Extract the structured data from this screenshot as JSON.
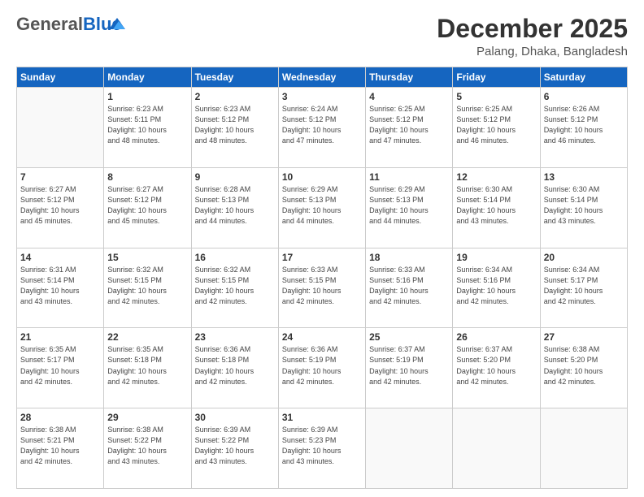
{
  "header": {
    "logo_general": "General",
    "logo_blue": "Blue",
    "month": "December 2025",
    "location": "Palang, Dhaka, Bangladesh"
  },
  "days_of_week": [
    "Sunday",
    "Monday",
    "Tuesday",
    "Wednesday",
    "Thursday",
    "Friday",
    "Saturday"
  ],
  "weeks": [
    [
      {
        "day": "",
        "info": ""
      },
      {
        "day": "1",
        "info": "Sunrise: 6:23 AM\nSunset: 5:11 PM\nDaylight: 10 hours\nand 48 minutes."
      },
      {
        "day": "2",
        "info": "Sunrise: 6:23 AM\nSunset: 5:12 PM\nDaylight: 10 hours\nand 48 minutes."
      },
      {
        "day": "3",
        "info": "Sunrise: 6:24 AM\nSunset: 5:12 PM\nDaylight: 10 hours\nand 47 minutes."
      },
      {
        "day": "4",
        "info": "Sunrise: 6:25 AM\nSunset: 5:12 PM\nDaylight: 10 hours\nand 47 minutes."
      },
      {
        "day": "5",
        "info": "Sunrise: 6:25 AM\nSunset: 5:12 PM\nDaylight: 10 hours\nand 46 minutes."
      },
      {
        "day": "6",
        "info": "Sunrise: 6:26 AM\nSunset: 5:12 PM\nDaylight: 10 hours\nand 46 minutes."
      }
    ],
    [
      {
        "day": "7",
        "info": "Sunrise: 6:27 AM\nSunset: 5:12 PM\nDaylight: 10 hours\nand 45 minutes."
      },
      {
        "day": "8",
        "info": "Sunrise: 6:27 AM\nSunset: 5:12 PM\nDaylight: 10 hours\nand 45 minutes."
      },
      {
        "day": "9",
        "info": "Sunrise: 6:28 AM\nSunset: 5:13 PM\nDaylight: 10 hours\nand 44 minutes."
      },
      {
        "day": "10",
        "info": "Sunrise: 6:29 AM\nSunset: 5:13 PM\nDaylight: 10 hours\nand 44 minutes."
      },
      {
        "day": "11",
        "info": "Sunrise: 6:29 AM\nSunset: 5:13 PM\nDaylight: 10 hours\nand 44 minutes."
      },
      {
        "day": "12",
        "info": "Sunrise: 6:30 AM\nSunset: 5:14 PM\nDaylight: 10 hours\nand 43 minutes."
      },
      {
        "day": "13",
        "info": "Sunrise: 6:30 AM\nSunset: 5:14 PM\nDaylight: 10 hours\nand 43 minutes."
      }
    ],
    [
      {
        "day": "14",
        "info": "Sunrise: 6:31 AM\nSunset: 5:14 PM\nDaylight: 10 hours\nand 43 minutes."
      },
      {
        "day": "15",
        "info": "Sunrise: 6:32 AM\nSunset: 5:15 PM\nDaylight: 10 hours\nand 42 minutes."
      },
      {
        "day": "16",
        "info": "Sunrise: 6:32 AM\nSunset: 5:15 PM\nDaylight: 10 hours\nand 42 minutes."
      },
      {
        "day": "17",
        "info": "Sunrise: 6:33 AM\nSunset: 5:15 PM\nDaylight: 10 hours\nand 42 minutes."
      },
      {
        "day": "18",
        "info": "Sunrise: 6:33 AM\nSunset: 5:16 PM\nDaylight: 10 hours\nand 42 minutes."
      },
      {
        "day": "19",
        "info": "Sunrise: 6:34 AM\nSunset: 5:16 PM\nDaylight: 10 hours\nand 42 minutes."
      },
      {
        "day": "20",
        "info": "Sunrise: 6:34 AM\nSunset: 5:17 PM\nDaylight: 10 hours\nand 42 minutes."
      }
    ],
    [
      {
        "day": "21",
        "info": "Sunrise: 6:35 AM\nSunset: 5:17 PM\nDaylight: 10 hours\nand 42 minutes."
      },
      {
        "day": "22",
        "info": "Sunrise: 6:35 AM\nSunset: 5:18 PM\nDaylight: 10 hours\nand 42 minutes."
      },
      {
        "day": "23",
        "info": "Sunrise: 6:36 AM\nSunset: 5:18 PM\nDaylight: 10 hours\nand 42 minutes."
      },
      {
        "day": "24",
        "info": "Sunrise: 6:36 AM\nSunset: 5:19 PM\nDaylight: 10 hours\nand 42 minutes."
      },
      {
        "day": "25",
        "info": "Sunrise: 6:37 AM\nSunset: 5:19 PM\nDaylight: 10 hours\nand 42 minutes."
      },
      {
        "day": "26",
        "info": "Sunrise: 6:37 AM\nSunset: 5:20 PM\nDaylight: 10 hours\nand 42 minutes."
      },
      {
        "day": "27",
        "info": "Sunrise: 6:38 AM\nSunset: 5:20 PM\nDaylight: 10 hours\nand 42 minutes."
      }
    ],
    [
      {
        "day": "28",
        "info": "Sunrise: 6:38 AM\nSunset: 5:21 PM\nDaylight: 10 hours\nand 42 minutes."
      },
      {
        "day": "29",
        "info": "Sunrise: 6:38 AM\nSunset: 5:22 PM\nDaylight: 10 hours\nand 43 minutes."
      },
      {
        "day": "30",
        "info": "Sunrise: 6:39 AM\nSunset: 5:22 PM\nDaylight: 10 hours\nand 43 minutes."
      },
      {
        "day": "31",
        "info": "Sunrise: 6:39 AM\nSunset: 5:23 PM\nDaylight: 10 hours\nand 43 minutes."
      },
      {
        "day": "",
        "info": ""
      },
      {
        "day": "",
        "info": ""
      },
      {
        "day": "",
        "info": ""
      }
    ]
  ]
}
